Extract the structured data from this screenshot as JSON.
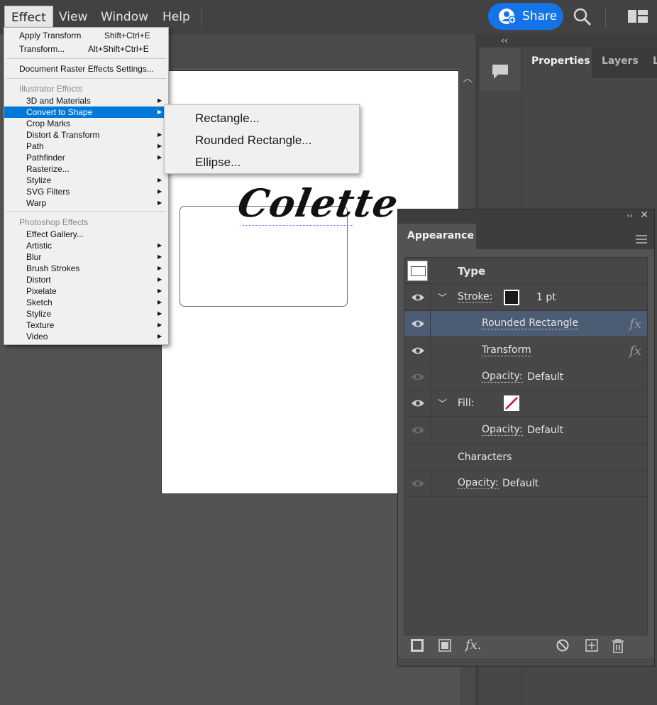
{
  "menubar": {
    "items": [
      "Effect",
      "View",
      "Window",
      "Help"
    ],
    "share_label": "Share"
  },
  "effect_menu": {
    "apply_transform": "Apply Transform",
    "apply_transform_shortcut": "Shift+Ctrl+E",
    "transform": "Transform...",
    "transform_shortcut": "Alt+Shift+Ctrl+E",
    "raster_settings": "Document Raster Effects Settings...",
    "illustrator_header": "Illustrator Effects",
    "illustrator_items": [
      "3D and Materials",
      "Convert to Shape",
      "Crop Marks",
      "Distort & Transform",
      "Path",
      "Pathfinder",
      "Rasterize...",
      "Stylize",
      "SVG Filters",
      "Warp"
    ],
    "photoshop_header": "Photoshop Effects",
    "photoshop_items": [
      "Effect Gallery...",
      "Artistic",
      "Blur",
      "Brush Strokes",
      "Distort",
      "Pixelate",
      "Sketch",
      "Stylize",
      "Texture",
      "Video"
    ],
    "highlighted": "Convert to Shape"
  },
  "submenu": {
    "items": [
      "Rectangle...",
      "Rounded Rectangle...",
      "Ellipse..."
    ]
  },
  "canvas": {
    "text": "Colette"
  },
  "dock": {
    "tabs": [
      "Properties",
      "Layers",
      "L"
    ]
  },
  "appearance": {
    "title": "Appearance",
    "type_label": "Type",
    "stroke_label": "Stroke:",
    "stroke_weight": "1 pt",
    "rounded_rect_label": "Rounded Rectangle",
    "transform_label": "Transform",
    "opacity_label": "Opacity:",
    "opacity_value": "Default",
    "fill_label": "Fill:",
    "characters_label": "Characters"
  },
  "colors": {
    "accent": "#1473e6",
    "menu_highlight": "#0078d7",
    "selected_row": "#4b5c73",
    "fill_none_slash": "#c8102e"
  }
}
